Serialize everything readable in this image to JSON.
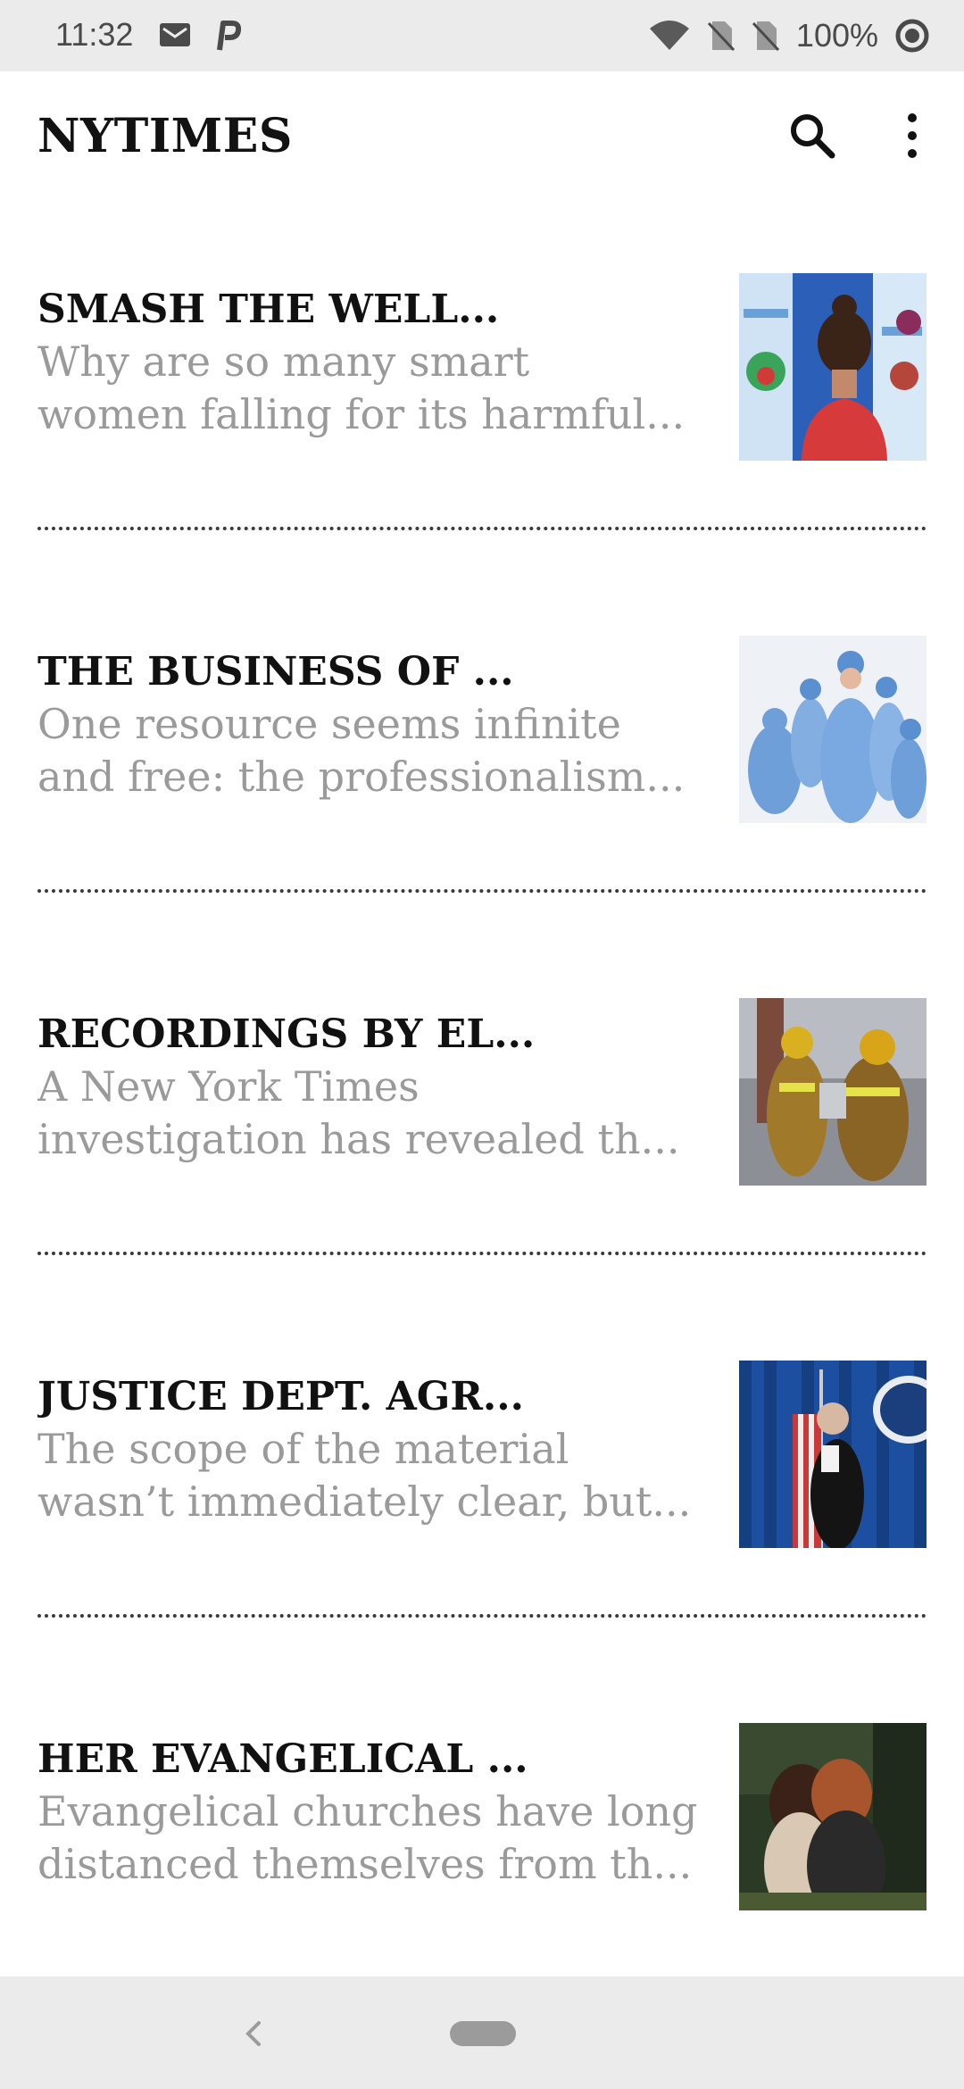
{
  "status_bar": {
    "time": "11:32",
    "battery": "100%",
    "icons": [
      "mail-icon",
      "p-icon",
      "wifi-icon",
      "no-sim-icon",
      "no-sim-icon",
      "battery-icon"
    ]
  },
  "app_bar": {
    "title": "NYTIMES",
    "icons": [
      "search-icon",
      "more-vert-icon"
    ]
  },
  "articles": [
    {
      "title": "SMASH THE WELL...",
      "summary_line1": "Why are so many smart",
      "summary_line2": "women falling for its harmful..."
    },
    {
      "title": "THE BUSINESS OF ...",
      "summary_line1": "One resource seems infinite",
      "summary_line2": "and free: the professionalism..."
    },
    {
      "title": "RECORDINGS BY EL...",
      "summary_line1": "A New York Times",
      "summary_line2": "investigation has revealed th..."
    },
    {
      "title": "JUSTICE DEPT. AGR...",
      "summary_line1": "The scope of the material",
      "summary_line2": "wasn’t immediately clear, but..."
    },
    {
      "title": "HER EVANGELICAL ...",
      "summary_line1": "Evangelical churches have long",
      "summary_line2": "distanced themselves from th..."
    }
  ],
  "nav_bar": {
    "icons": [
      "back-icon",
      "home-pill-icon"
    ]
  }
}
